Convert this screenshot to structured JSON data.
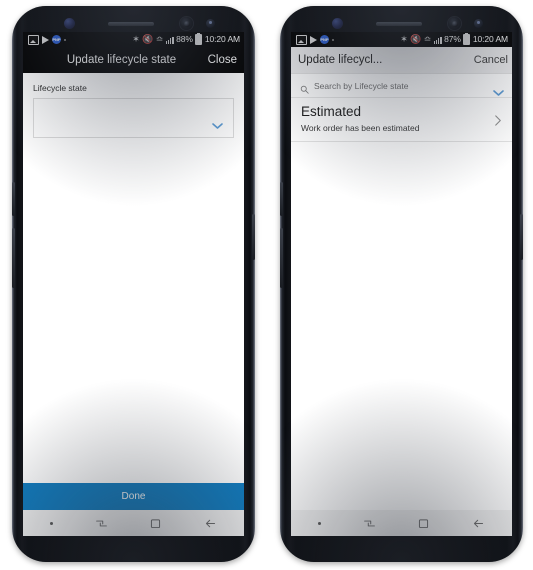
{
  "page": {
    "title": "Update lifecycle state — mobile app, two states"
  },
  "phone_left": {
    "status_bar": {
      "icons": [
        "gallery-icon",
        "play-store-icon",
        "app-badge-icon",
        "dot-icon"
      ],
      "badge_text": "PNP",
      "bluetooth": "bluetooth-icon",
      "mute": "mute-icon",
      "wifi": "wifi-icon",
      "signal": "signal-bars-icon",
      "battery_percent": "88%",
      "battery": "battery-icon",
      "time": "10:20 AM"
    },
    "appbar": {
      "title": "Update lifecycle state",
      "action_label": "Close"
    },
    "form": {
      "field_label": "Lifecycle state",
      "combo_value": "",
      "combo_chevron": "chevron-down-icon"
    },
    "footer": {
      "done_label": "Done"
    },
    "navbar": {
      "recents": "recents-icon",
      "home": "home-icon",
      "back": "back-icon"
    }
  },
  "phone_right": {
    "status_bar": {
      "icons": [
        "gallery-icon",
        "play-store-icon",
        "app-badge-icon",
        "dot-icon"
      ],
      "badge_text": "PNP",
      "bluetooth": "bluetooth-icon",
      "mute": "mute-icon",
      "wifi": "wifi-icon",
      "signal": "signal-bars-icon",
      "battery_percent": "87%",
      "battery": "battery-icon",
      "time": "10:20 AM"
    },
    "appbar": {
      "title": "Update lifecycl...",
      "action_label": "Cancel"
    },
    "search": {
      "icon": "search-icon",
      "placeholder": "Search by Lifecycle state",
      "chevron": "chevron-down-icon"
    },
    "list": {
      "items": [
        {
          "title": "Estimated",
          "subtitle": "Work order has been estimated",
          "chevron": "chevron-right-icon"
        }
      ]
    },
    "navbar": {
      "recents": "recents-icon",
      "home": "home-icon",
      "back": "back-icon"
    }
  },
  "colors": {
    "accent_blue": "#107cc0",
    "chevron_blue": "#5b9bd5",
    "appbar_dark": "#000000",
    "appbar_light": "#ececed",
    "navbar_bg": "#f2f2f2",
    "badge_blue": "#2a5fd6"
  }
}
